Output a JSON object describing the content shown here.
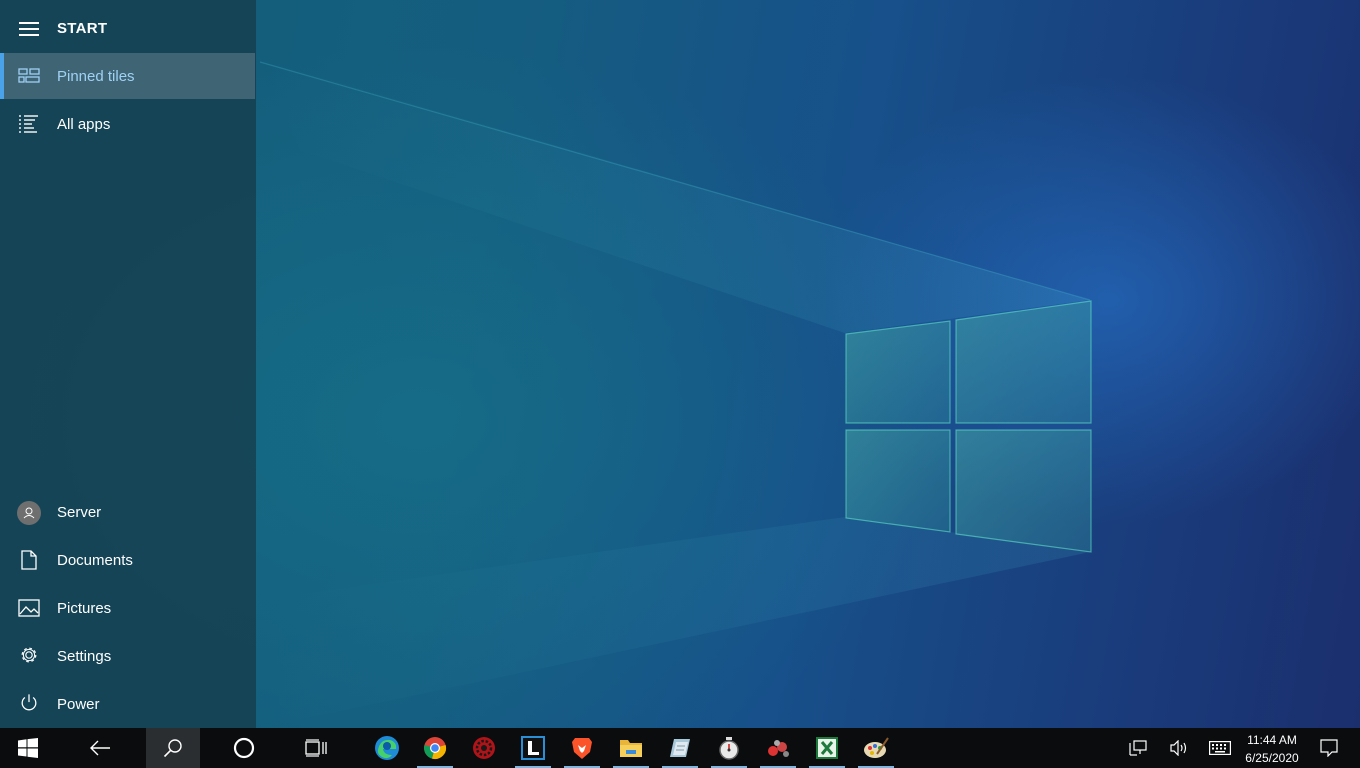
{
  "start_menu": {
    "title": "START",
    "nav": [
      {
        "label": "Pinned tiles",
        "icon": "pinned-tiles-icon",
        "active": true
      },
      {
        "label": "All apps",
        "icon": "all-apps-icon",
        "active": false
      }
    ],
    "bottom": [
      {
        "label": "Server",
        "icon": "user-avatar-icon"
      },
      {
        "label": "Documents",
        "icon": "document-icon"
      },
      {
        "label": "Pictures",
        "icon": "pictures-icon"
      },
      {
        "label": "Settings",
        "icon": "gear-icon"
      },
      {
        "label": "Power",
        "icon": "power-icon"
      }
    ]
  },
  "taskbar": {
    "buttons": [
      "windows-start-icon",
      "back-arrow-icon",
      "search-icon",
      "cortana-icon",
      "task-view-icon"
    ],
    "apps": [
      "edge-icon",
      "chrome-icon",
      "red-gear-app-icon",
      "l-app-icon",
      "brave-icon",
      "file-explorer-icon",
      "notepad-icon",
      "stopwatch-icon",
      "paint-spheres-icon",
      "excel-icon",
      "paint-palette-icon"
    ],
    "tray": [
      "network-icon",
      "volume-icon",
      "keyboard-icon",
      "notification-icon"
    ],
    "clock": {
      "time": "11:44 AM",
      "date": "6/25/2020"
    }
  },
  "colors": {
    "accent": "#4aa3e8",
    "taskbar": "#0a0c0e",
    "panel": "#163e4e"
  }
}
